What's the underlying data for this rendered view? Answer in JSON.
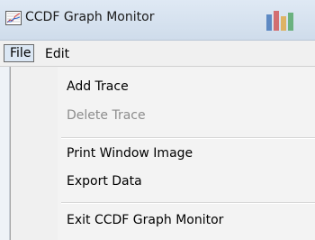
{
  "window": {
    "title": "CCDF Graph Monitor",
    "app_icon": "graph-icon",
    "title_decoration_icon": "colorful-bars-icon"
  },
  "menubar": {
    "file_label": "File",
    "edit_label": "Edit"
  },
  "file_menu": {
    "items": [
      {
        "label": "Add Trace",
        "enabled": true
      },
      {
        "label": "Delete Trace",
        "enabled": false
      },
      {
        "label": "Print Window Image",
        "enabled": true
      },
      {
        "label": "Export Data",
        "enabled": true
      },
      {
        "label": "Exit CCDF Graph Monitor",
        "enabled": true
      }
    ]
  },
  "colors": {
    "titlebar": "#cfdceb",
    "menu_highlight": "#dbe7f4",
    "disabled_text": "#8d8d8d"
  }
}
